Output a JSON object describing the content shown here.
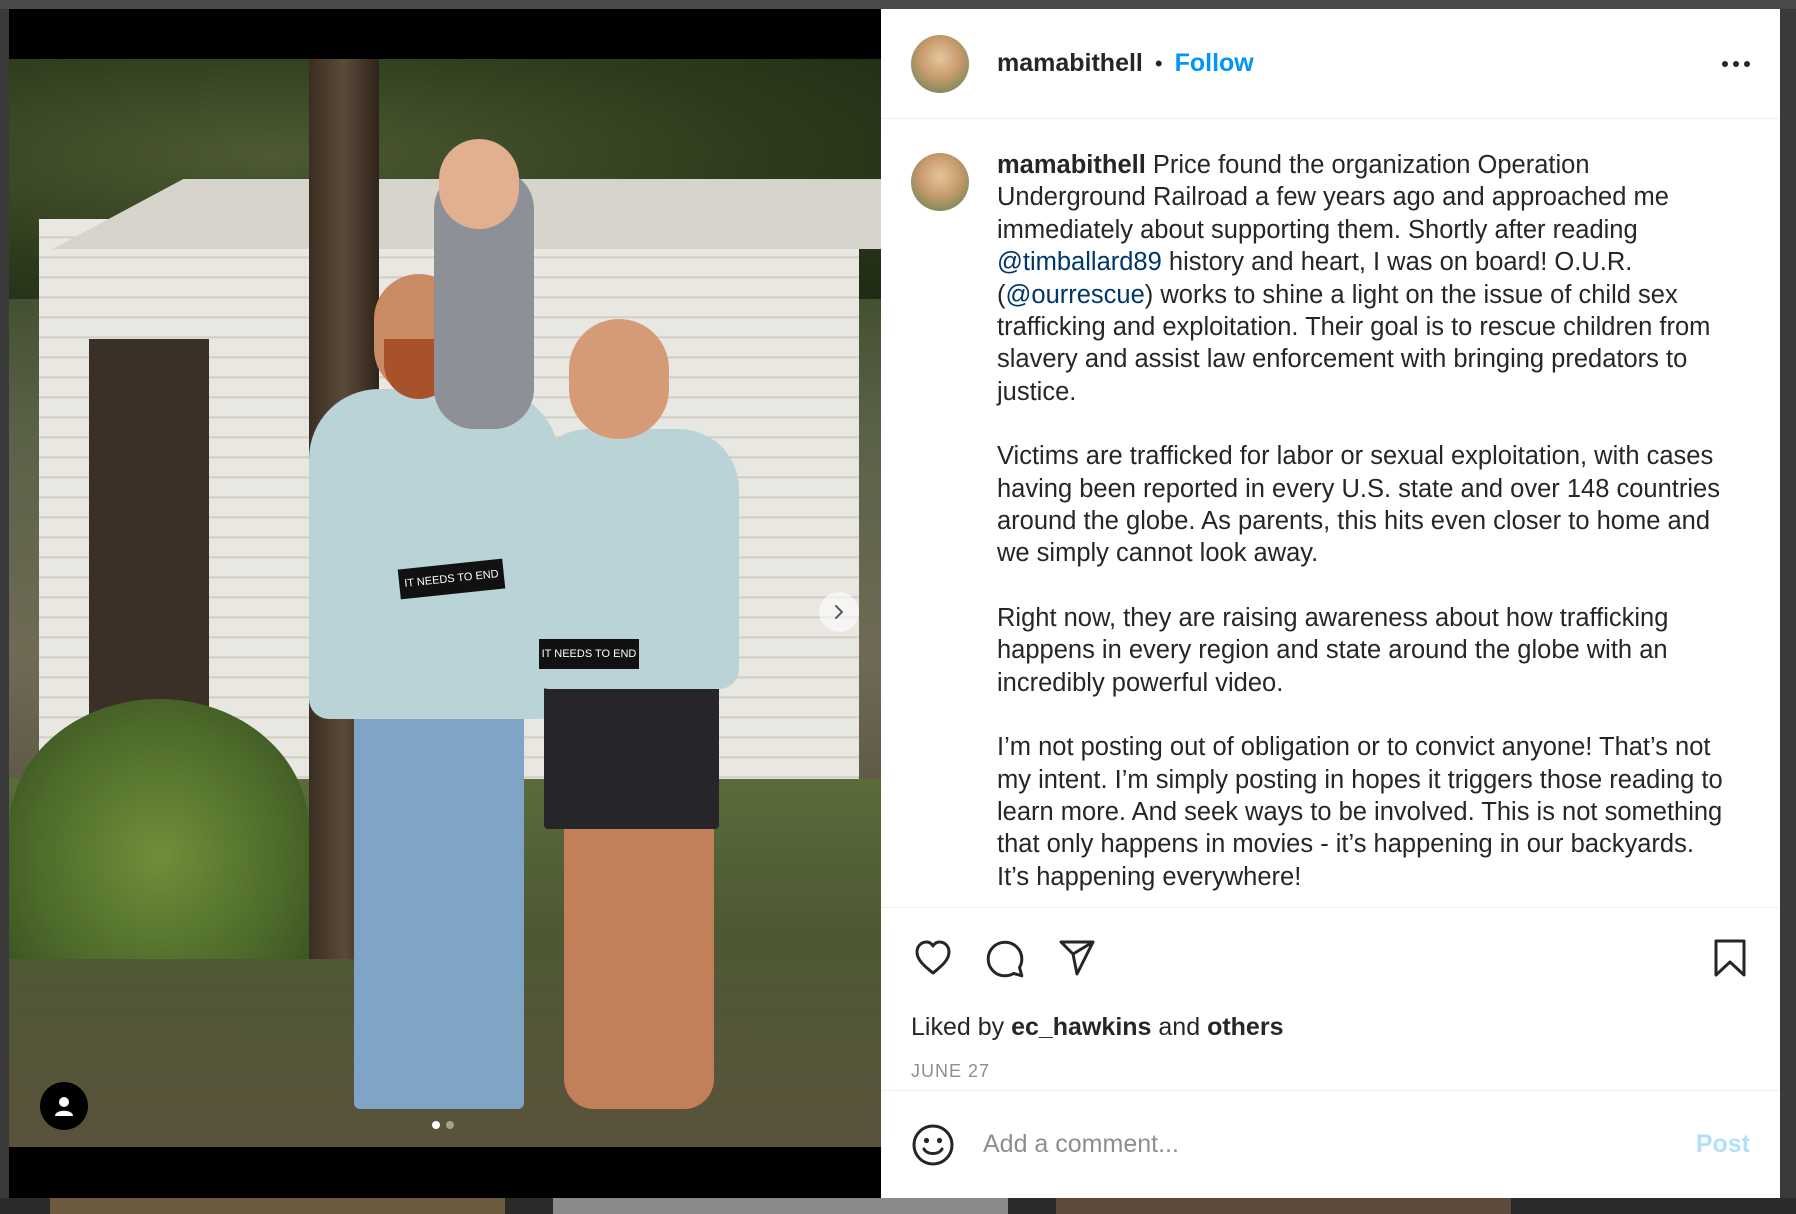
{
  "post": {
    "username": "mamabithell",
    "separator": "•",
    "follow_label": "Follow",
    "caption": {
      "username": "mamabithell",
      "p1_a": "Price found the organization Operation Underground Railroad a few years ago and approached me immediately about supporting them. Shortly after reading ",
      "p1_mention1": "@timballard89",
      "p1_b": " history and heart, I was on board! O.U.R. (",
      "p1_mention2": "@ourrescue",
      "p1_c": ") works to shine a light on the issue of child sex trafficking and exploitation. Their goal is to rescue children from slavery and assist law enforcement with bringing predators to justice.",
      "p2": "Victims are trafficked for labor or sexual exploitation, with cases having been reported in every U.S. state and over 148 countries around the globe. As parents, this hits even closer to home and we simply cannot look away.",
      "p3": "Right now, they are raising awareness about how trafficking happens in every region and state around the globe with an incredibly powerful video.",
      "p4": "I’m not posting out of obligation or to convict anyone! That’s not my intent. I’m simply posting in hopes it triggers those reading to learn more. And seek ways to be involved. This is not something that only happens in movies - it’s happening in our backyards. It’s happening everywhere!"
    },
    "likes": {
      "prefix": "Liked by",
      "user": "ec_hawkins",
      "middle": "and",
      "others": "others"
    },
    "date": "JUNE 27",
    "comment": {
      "placeholder": "Add a comment...",
      "post_label": "Post"
    },
    "media": {
      "shirt_text_man": "IT NEEDS TO END",
      "shirt_text_woman": "IT NEEDS TO END",
      "carousel_dots": 2,
      "active_dot": 1
    },
    "icons": {
      "like": "heart-icon",
      "comment": "comment-icon",
      "share": "paper-plane-icon",
      "save": "bookmark-icon",
      "emoji": "smiley-icon",
      "more": "more-horizontal-icon",
      "next": "chevron-right-icon",
      "tagged_users": "user-icon"
    },
    "colors": {
      "follow": "#0095f6",
      "post_disabled": "#b2dffc",
      "mention": "#00376b",
      "text": "#262626",
      "muted": "#8e8e8e"
    }
  }
}
